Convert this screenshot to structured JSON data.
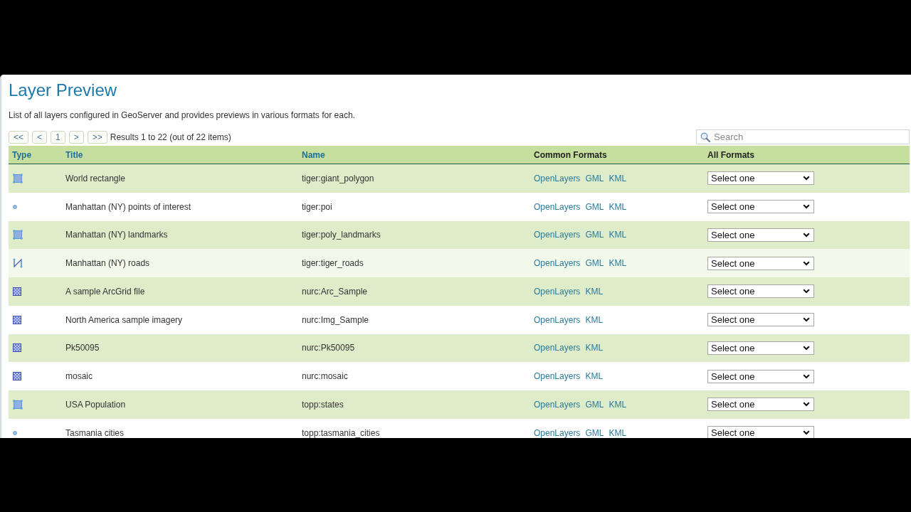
{
  "page": {
    "title": "Layer Preview",
    "description": "List of all layers configured in GeoServer and provides previews in various formats for each."
  },
  "pager": {
    "buttons": [
      "<<",
      "<",
      "1",
      ">",
      ">>"
    ],
    "summary": "Results 1 to 22 (out of 22 items)"
  },
  "search": {
    "placeholder": "Search"
  },
  "table": {
    "columns": [
      {
        "label": "Type",
        "sortable": true
      },
      {
        "label": "Title",
        "sortable": true
      },
      {
        "label": "Name",
        "sortable": true
      },
      {
        "label": "Common Formats",
        "sortable": false
      },
      {
        "label": "All Formats",
        "sortable": false
      }
    ],
    "rows": [
      {
        "kind": "polygon",
        "title": "World rectangle",
        "name": "tiger:giant_polygon",
        "formats": [
          "OpenLayers",
          "GML",
          "KML"
        ],
        "all_formats": "Select one",
        "hovered": false
      },
      {
        "kind": "point",
        "title": "Manhattan (NY) points of interest",
        "name": "tiger:poi",
        "formats": [
          "OpenLayers",
          "GML",
          "KML"
        ],
        "all_formats": "Select one",
        "hovered": false
      },
      {
        "kind": "polygon",
        "title": "Manhattan (NY) landmarks",
        "name": "tiger:poly_landmarks",
        "formats": [
          "OpenLayers",
          "GML",
          "KML"
        ],
        "all_formats": "Select one",
        "hovered": false
      },
      {
        "kind": "line",
        "title": "Manhattan (NY) roads",
        "name": "tiger:tiger_roads",
        "formats": [
          "OpenLayers",
          "GML",
          "KML"
        ],
        "all_formats": "Select one",
        "hovered": true
      },
      {
        "kind": "raster",
        "title": "A sample ArcGrid file",
        "name": "nurc:Arc_Sample",
        "formats": [
          "OpenLayers",
          "KML"
        ],
        "all_formats": "Select one",
        "hovered": false
      },
      {
        "kind": "raster",
        "title": "North America sample imagery",
        "name": "nurc:Img_Sample",
        "formats": [
          "OpenLayers",
          "KML"
        ],
        "all_formats": "Select one",
        "hovered": false
      },
      {
        "kind": "raster",
        "title": "Pk50095",
        "name": "nurc:Pk50095",
        "formats": [
          "OpenLayers",
          "KML"
        ],
        "all_formats": "Select one",
        "hovered": false
      },
      {
        "kind": "raster",
        "title": "mosaic",
        "name": "nurc:mosaic",
        "formats": [
          "OpenLayers",
          "KML"
        ],
        "all_formats": "Select one",
        "hovered": false
      },
      {
        "kind": "polygon",
        "title": "USA Population",
        "name": "topp:states",
        "formats": [
          "OpenLayers",
          "GML",
          "KML"
        ],
        "all_formats": "Select one",
        "hovered": false
      },
      {
        "kind": "point",
        "title": "Tasmania cities",
        "name": "topp:tasmania_cities",
        "formats": [
          "OpenLayers",
          "GML",
          "KML"
        ],
        "all_formats": "Select one",
        "hovered": false
      }
    ]
  }
}
